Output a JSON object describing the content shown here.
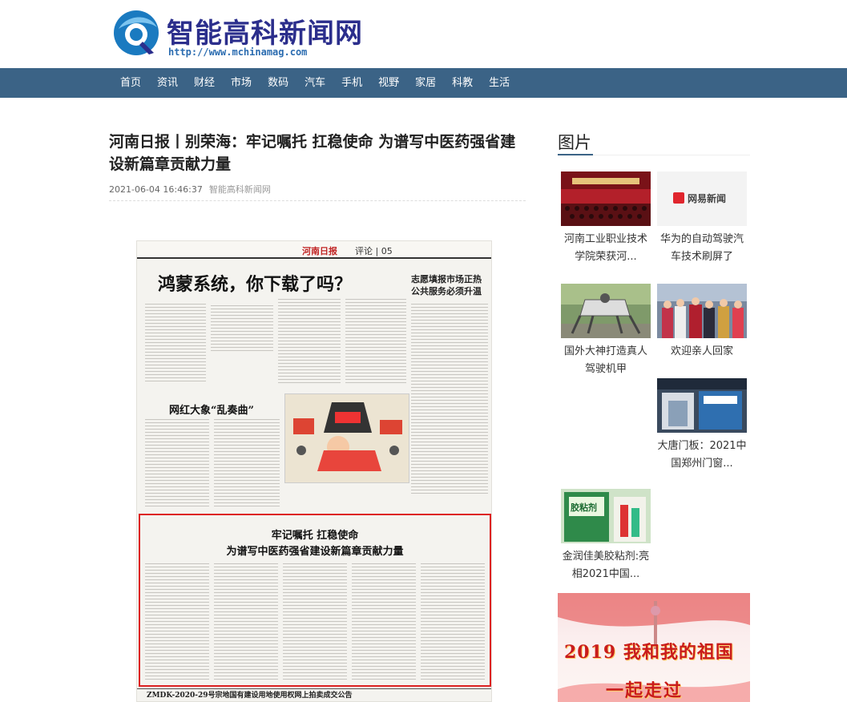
{
  "site": {
    "name": "智能高科新闻网",
    "url": "http://www.mchinamag.com"
  },
  "nav": [
    "首页",
    "资讯",
    "财经",
    "市场",
    "数码",
    "汽车",
    "手机",
    "视野",
    "家居",
    "科教",
    "生活"
  ],
  "article": {
    "title": "河南日报丨别荣海：牢记嘱托 扛稳使命 为谱写中医药强省建设新篇章贡献力量",
    "date": "2021-06-04 16:46:37",
    "source": "智能高科新闻网"
  },
  "newspaper": {
    "name": "河南日报",
    "section": "评论 | 05",
    "headline": "鸿蒙系统，你下载了吗？",
    "side_headline": "志愿填报市场正热 公共服务必须升温",
    "mid_headline": "网红大象“乱奏曲”",
    "box_headline_1": "牢记嘱托  扛稳使命",
    "box_headline_2": "为谱写中医药强省建设新篇章贡献力量",
    "bottom_line": "ZMDK-2020-29号宗地国有建设用地使用权网上拍卖成交公告"
  },
  "sidebar": {
    "title": "图片",
    "items": [
      {
        "caption": "河南工业职业技术学院荣获河..."
      },
      {
        "caption": "华为的自动驾驶汽车技术刷屏了",
        "thumb_logo": "网易新闻"
      },
      {
        "caption": "国外大神打造真人驾驶机甲"
      },
      {
        "caption": "欢迎亲人回家"
      },
      {
        "caption": "大唐门板：2021中国郑州门窗..."
      },
      {
        "caption": "金润佳美胶粘剂:亮相2021中国...",
        "thumb_label": "胶粘剂"
      }
    ],
    "banner": {
      "line1": "2019 我和我的祖国",
      "line2": "一起走过"
    }
  },
  "colors": {
    "nav_bg": "#3b6386",
    "brand": "#2b2e8c",
    "accent_red": "#c91c1c"
  }
}
